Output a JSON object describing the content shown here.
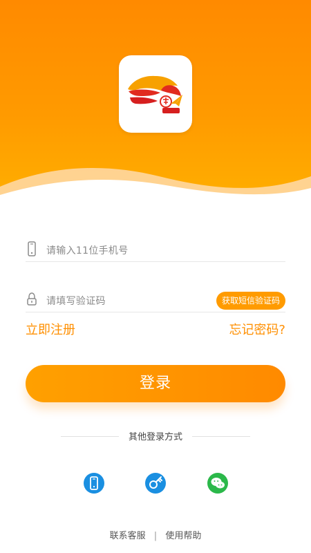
{
  "theme": {
    "accent": "#ff8f00",
    "accent_gradient_left": "#ffa000",
    "accent_gradient_right": "#ff8a00",
    "header_gradient_top": "#ff8a00",
    "header_gradient_bottom": "#ffb000",
    "social_blue": "#1a8fe1",
    "social_green": "#2bb84a"
  },
  "form": {
    "phone_placeholder": "请输入11位手机号",
    "phone_icon": "mobile-phone-icon",
    "code_placeholder": "请填写验证码",
    "code_icon": "lock-icon",
    "sms_button": "获取短信验证码"
  },
  "links": {
    "register": "立即注册",
    "forgot_password": "忘记密码?"
  },
  "actions": {
    "login": "登录"
  },
  "other_login": {
    "title": "其他登录方式",
    "methods": [
      {
        "icon": "phone-login-icon"
      },
      {
        "icon": "key-login-icon"
      },
      {
        "icon": "wechat-login-icon"
      }
    ]
  },
  "footer": {
    "contact": "联系客服",
    "separator": "|",
    "help": "使用帮助"
  }
}
